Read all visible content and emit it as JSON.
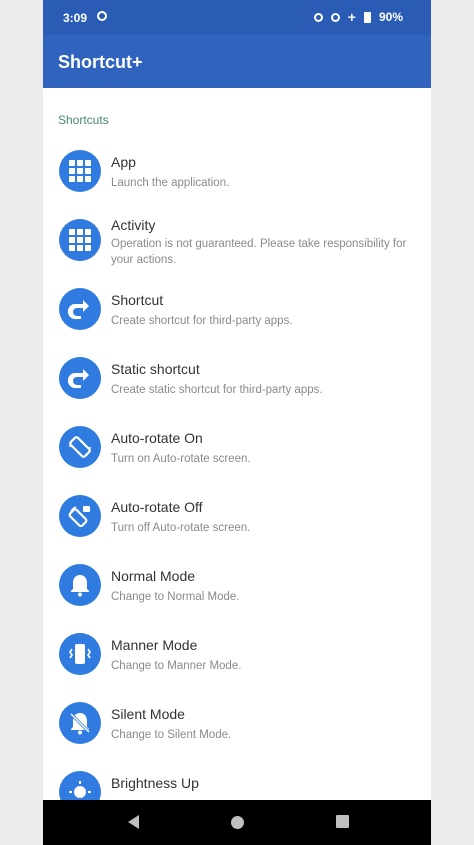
{
  "status_bar": {
    "time": "3:09",
    "battery": "90%"
  },
  "app_bar": {
    "title": "Shortcut+"
  },
  "section": {
    "header": "Shortcuts"
  },
  "items": [
    {
      "title": "App",
      "subtitle": "Launch the application.",
      "icon": "grid-icon"
    },
    {
      "title": "Activity",
      "subtitle": "Operation is not guaranteed. Please take responsibility for your actions.",
      "icon": "grid-icon"
    },
    {
      "title": "Shortcut",
      "subtitle": "Create shortcut for third-party apps.",
      "icon": "shortcut-arrow-icon"
    },
    {
      "title": "Static shortcut",
      "subtitle": "Create static shortcut for third-party apps.",
      "icon": "shortcut-arrow-icon"
    },
    {
      "title": "Auto-rotate On",
      "subtitle": "Turn on Auto-rotate screen.",
      "icon": "screen-rotation-icon"
    },
    {
      "title": "Auto-rotate Off",
      "subtitle": "Turn off Auto-rotate screen.",
      "icon": "screen-lock-rotation-icon"
    },
    {
      "title": "Normal Mode",
      "subtitle": "Change to Normal Mode.",
      "icon": "bell-icon"
    },
    {
      "title": "Manner Mode",
      "subtitle": "Change to Manner Mode.",
      "icon": "vibrate-icon"
    },
    {
      "title": "Silent Mode",
      "subtitle": "Change to Silent Mode.",
      "icon": "bell-off-icon"
    },
    {
      "title": "Brightness Up",
      "subtitle": "",
      "icon": "brightness-icon"
    }
  ],
  "colors": {
    "primary": "#2f63bd",
    "status_bar": "#2a5cb5",
    "icon_bg": "#2f7be0",
    "section_header": "#4a8a6a"
  }
}
